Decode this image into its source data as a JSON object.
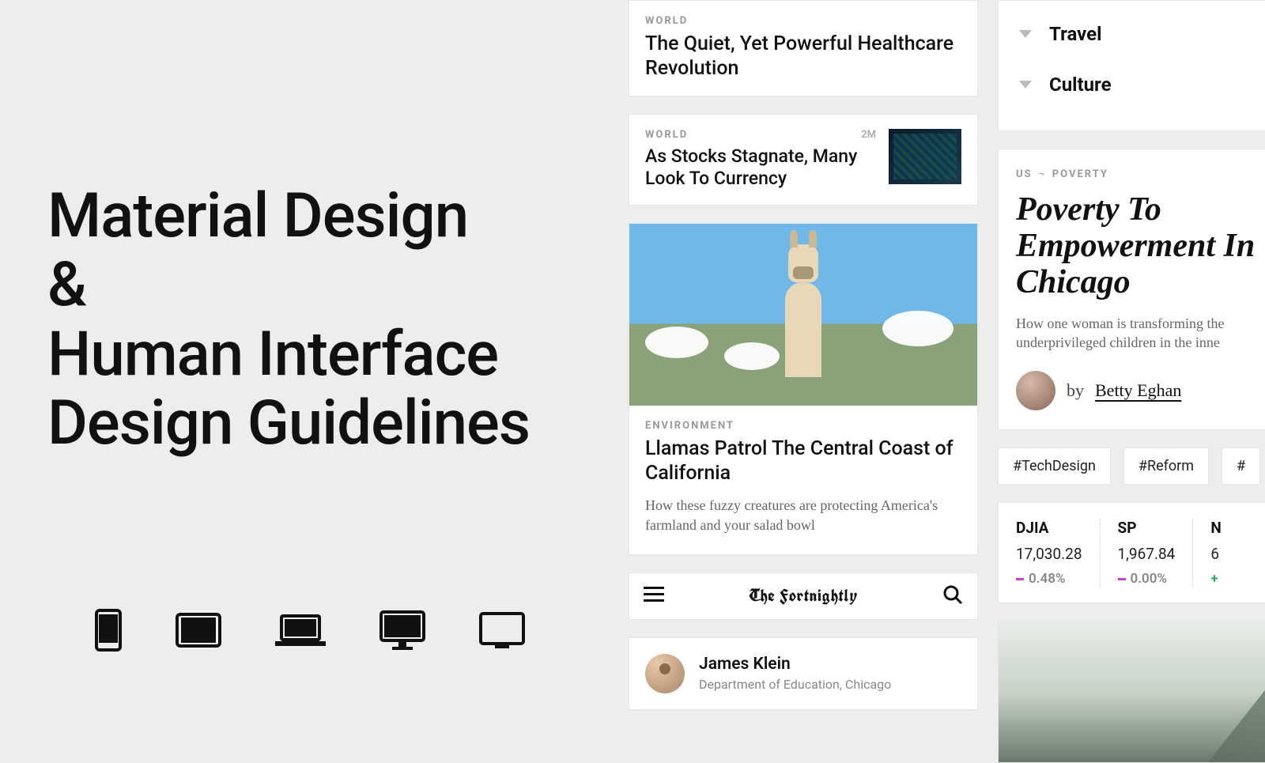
{
  "title_lines": [
    "Material Design",
    "&",
    "Human Interface",
    "Design Guidelines"
  ],
  "cards": {
    "world1": {
      "category": "WORLD",
      "headline": "The Quiet, Yet Powerful Healthcare Revolution"
    },
    "world2": {
      "category": "WORLD",
      "time": "2M",
      "headline": "As Stocks Stagnate, Many Look To Currency"
    },
    "env": {
      "category": "ENVIRONMENT",
      "headline": "Llamas Patrol The Central Coast of California",
      "sub": "How these fuzzy creatures are protecting America's farmland and your salad bowl"
    }
  },
  "search": {
    "logo": "The Fortnightly"
  },
  "author": {
    "name": "James Klein",
    "role": "Department of Education, Chicago"
  },
  "nav": {
    "items": [
      {
        "label": "Travel"
      },
      {
        "label": "Culture"
      }
    ]
  },
  "article": {
    "bc1": "US",
    "bc2": "POVERTY",
    "title": "Poverty To Empowerment In Chicago",
    "sub": "How one woman is transforming the underprivileged children in the inne",
    "by": "by",
    "name": "Betty Eghan"
  },
  "tags": [
    "#TechDesign",
    "#Reform",
    "#"
  ],
  "stocks": [
    {
      "sym": "DJIA",
      "val": "17,030.28",
      "chg": "0.48%",
      "dir": "neg"
    },
    {
      "sym": "SP",
      "val": "1,967.84",
      "chg": "0.00%",
      "dir": "neg"
    },
    {
      "sym": "N",
      "val": "6",
      "chg": "",
      "dir": "pos"
    }
  ]
}
